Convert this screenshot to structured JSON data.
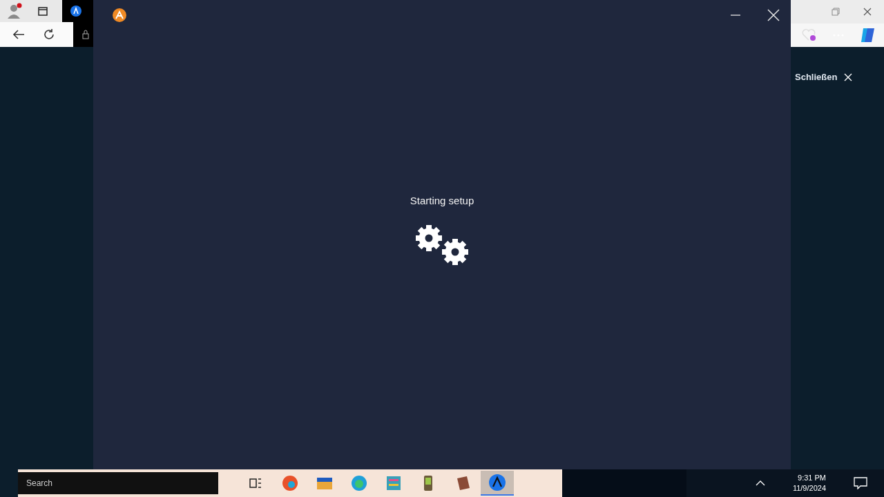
{
  "setup_window": {
    "message": "Starting setup"
  },
  "browser_panel": {
    "close_label": "Schließen"
  },
  "taskbar": {
    "search_placeholder": "Search",
    "apps": [
      {
        "kind": "task-view",
        "selected": false
      },
      {
        "kind": "edge",
        "selected": false
      },
      {
        "kind": "folder",
        "selected": false
      },
      {
        "kind": "firefox",
        "selected": false
      },
      {
        "kind": "archive",
        "selected": false
      },
      {
        "kind": "phone",
        "selected": false
      },
      {
        "kind": "book",
        "selected": false
      },
      {
        "kind": "setup",
        "selected": true
      }
    ],
    "time": "9:31 PM",
    "date": "11/9/2024"
  }
}
